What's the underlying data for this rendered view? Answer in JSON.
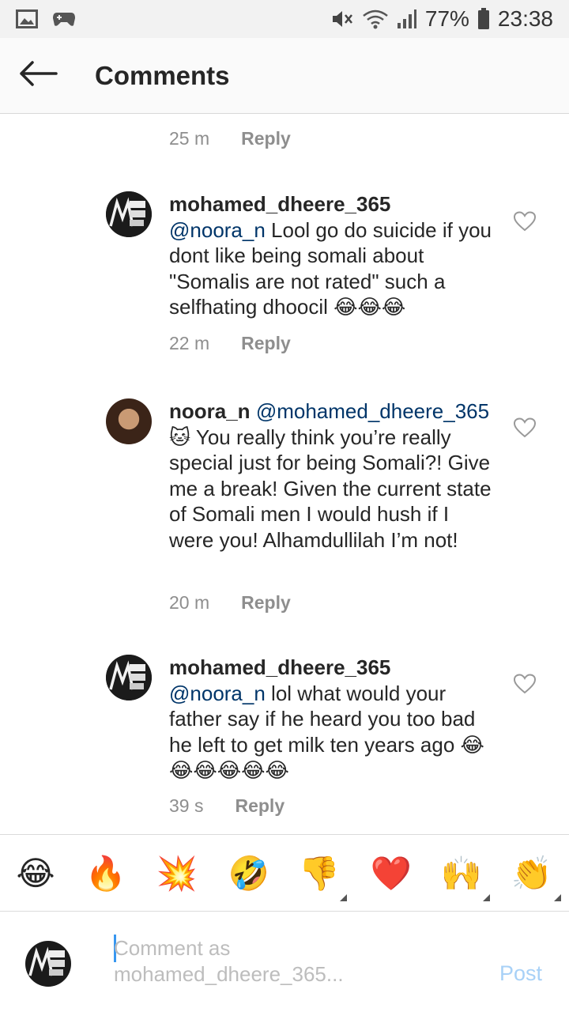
{
  "status_bar": {
    "battery_percent": "77%",
    "time": "23:38",
    "icons": [
      "gallery-icon",
      "game-controller-icon",
      "mute-icon",
      "wifi-icon",
      "signal-icon",
      "battery-icon"
    ]
  },
  "header": {
    "title": "Comments",
    "back_icon": "back-arrow-icon"
  },
  "comments": [
    {
      "time": "25 m",
      "reply_label": "Reply"
    },
    {
      "username": "mohamed_dheere_365",
      "mention": "@noora_n",
      "text": " Lool go do suicide if you dont like being somali about \"Somalis are not rated\" such a selfhating dhoocil 😂😂😂",
      "time": "22 m",
      "reply_label": "Reply",
      "avatar_text": "MONEY MAKIN MALIS"
    },
    {
      "username": "noora_n",
      "mention": "@mohamed_dheere_365",
      "text": " 🐱 You really think you’re really special just for being Somali?! Give me a break! Given the current state of Somali men I would hush if I were you! Alhamdullilah I’m not!",
      "time": "20 m",
      "reply_label": "Reply"
    },
    {
      "username": "mohamed_dheere_365",
      "mention": "@noora_n",
      "text": " lol what would your father say if he heard you too bad he left to get milk ten years ago 😂😂😂😂😂😂",
      "time": "39 s",
      "reply_label": "Reply",
      "avatar_text": "MONEY MAKIN MALIS"
    }
  ],
  "emoji_bar": [
    "😂",
    "🔥",
    "💥",
    "🤣",
    "👎",
    "❤️",
    "🙌",
    "👏"
  ],
  "compose": {
    "placeholder_line1": "Comment as",
    "placeholder_line2": "mohamed_dheere_365...",
    "post_label": "Post"
  },
  "colors": {
    "mention": "#003569",
    "meta": "#8e8e8e",
    "post_disabled": "#a8d1f7",
    "caret": "#3897f0"
  }
}
